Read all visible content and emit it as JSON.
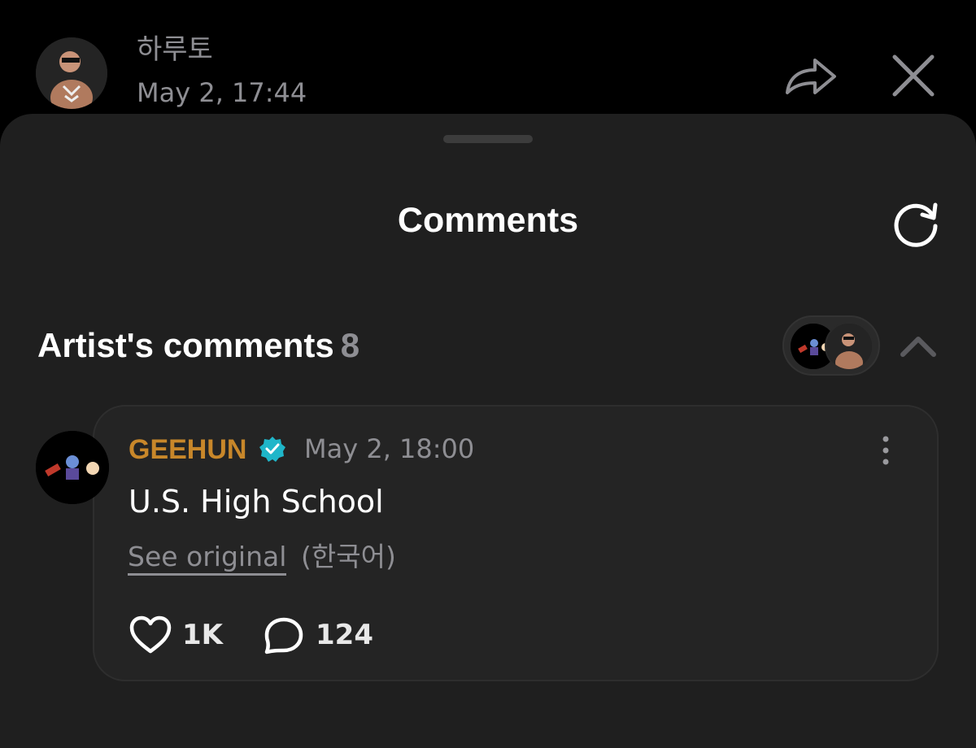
{
  "header": {
    "artist_name": "하루토",
    "post_date": "May 2, 17:44"
  },
  "sheet": {
    "title": "Comments"
  },
  "artist_comments": {
    "title": "Artist's comments",
    "count": "8"
  },
  "comment": {
    "author": "GEEHUN",
    "date": "May 2, 18:00",
    "body": "U.S. High School",
    "see_original": "See original",
    "language": "(한국어)",
    "likes": "1K",
    "replies": "124"
  },
  "colors": {
    "background": "#000000",
    "sheet": "#1f1f1f",
    "card": "#242424",
    "author": "#c8872a",
    "verified": "#1fb6c9",
    "muted": "#8e8e93"
  },
  "icons": [
    "share-icon",
    "close-icon",
    "refresh-icon",
    "chevron-up-icon",
    "verified-badge-icon",
    "more-vertical-icon",
    "heart-icon",
    "chat-bubble-icon"
  ]
}
